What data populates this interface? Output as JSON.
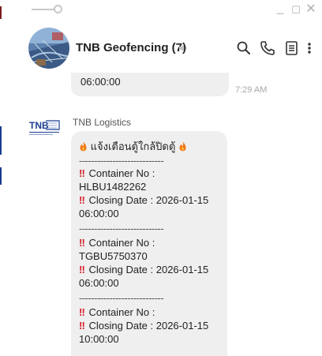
{
  "window": {
    "minimize_glyph": "_",
    "maximize_glyph": "☐",
    "close_glyph": "✕"
  },
  "header": {
    "chat_title": "TNB Geofencing (7)",
    "icons": [
      "search-icon",
      "phone-icon",
      "notes-icon",
      "more-icon"
    ]
  },
  "previous_message": {
    "text": "06:00:00",
    "time": "7:29 AM"
  },
  "message": {
    "sender": "TNB Logistics",
    "title": "แจ้งเตือนตู้ใกล้ปิดตู้",
    "separator": "----------------------------",
    "alert_mark": "‼",
    "entries": [
      {
        "container_label": "Container No :",
        "container_no": "HLBU1482262",
        "closing_label": "Closing Date : 2026-01-15",
        "closing_time": "06:00:00"
      },
      {
        "container_label": "Container No :",
        "container_no": "TGBU5750370",
        "closing_label": "Closing Date : 2026-01-15",
        "closing_time": "06:00:00"
      },
      {
        "container_label": "Container No :",
        "closing_label": "Closing Date : 2026-01-15",
        "closing_time": "10:00:00"
      }
    ]
  },
  "colors": {
    "bubble": "#efefef",
    "alert": "#d4202a",
    "fire": "#f07a1a"
  }
}
